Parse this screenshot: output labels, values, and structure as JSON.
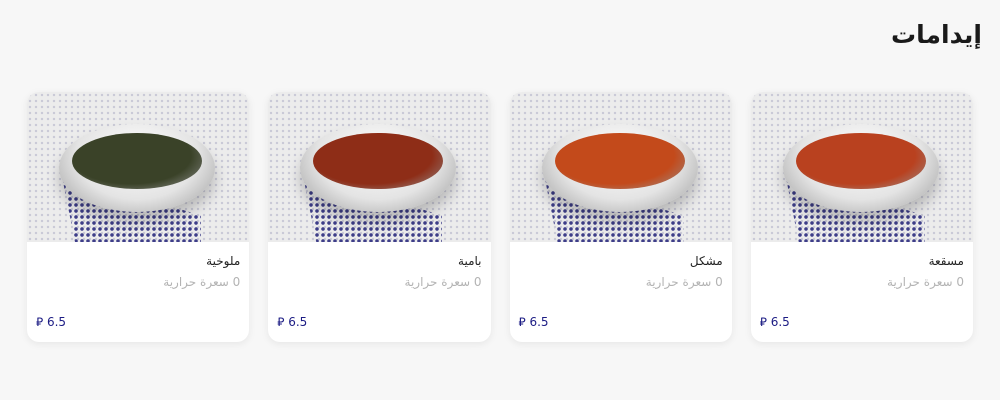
{
  "section": {
    "title": "إيدامات"
  },
  "currency_symbol": "⃁",
  "items": [
    {
      "name": "مسقعة",
      "calories": "0 سعرة حرارية",
      "price": "6.5",
      "food_color": "#b9411f",
      "food_icon": "bowl-icon"
    },
    {
      "name": "مشكل",
      "calories": "0 سعرة حرارية",
      "price": "6.5",
      "food_color": "#c34a1b",
      "food_icon": "bowl-icon"
    },
    {
      "name": "بامية",
      "calories": "0 سعرة حرارية",
      "price": "6.5",
      "food_color": "#8e2d17",
      "food_icon": "bowl-icon"
    },
    {
      "name": "ملوخية",
      "calories": "0 سعرة حرارية",
      "price": "6.5",
      "food_color": "#3a4228",
      "food_icon": "bowl-icon"
    }
  ]
}
